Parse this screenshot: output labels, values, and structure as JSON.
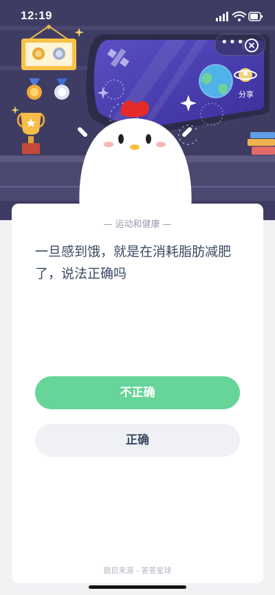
{
  "status_bar": {
    "time": "12:19"
  },
  "capsule": {
    "more_label": "•••"
  },
  "scene": {
    "share_label": "分享"
  },
  "quiz": {
    "category": "— 运动和健康 —",
    "question": "一旦感到饿，就是在消耗脂肪减肥了，说法正确吗",
    "options": [
      {
        "label": "不正确"
      },
      {
        "label": "正确"
      }
    ],
    "source": "题目来源 - 答答星球"
  },
  "colors": {
    "primary_button": "#67d49a",
    "secondary_button": "#f0f1f5",
    "scene_background": "#3f3c63",
    "question_text": "#3a4a63"
  }
}
